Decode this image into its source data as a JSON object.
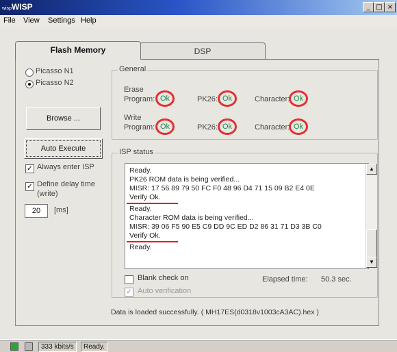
{
  "window": {
    "title_prefix": "wisp",
    "title": "WISP",
    "controls": [
      "_",
      "□",
      "×"
    ]
  },
  "menu": [
    "File",
    "View",
    "Settings",
    "Help"
  ],
  "tabs": [
    "Flash Memory",
    "DSP"
  ],
  "radios": [
    {
      "label": "Picasso N1",
      "selected": false
    },
    {
      "label": "Picasso N2",
      "selected": true
    }
  ],
  "buttons": {
    "browse": "Browse ...",
    "auto_execute": "Auto Execute"
  },
  "options": {
    "always_enter_isp": {
      "label": "Always enter ISP",
      "checked": true
    },
    "define_delay": {
      "label_1": "Define delay time",
      "label_2": "(write)",
      "checked": true
    }
  },
  "delay": {
    "value": "20",
    "unit": "[ms]"
  },
  "general": {
    "title": "General",
    "erase_label": "Erase",
    "write_label": "Write",
    "program_label": "Program:",
    "pk26_label": "PK26:",
    "character_label": "Character:",
    "ok": "Ok"
  },
  "isp": {
    "title": "ISP status",
    "log": [
      "Ready.",
      "PK26 ROM data is being verified...",
      "MISR: 17 56 89 79 50 FC F0 48 96 D4 71 15 09 B2 E4 0E",
      "Verify Ok.",
      "Ready.",
      "Character ROM data is being verified...",
      "MISR: 39 06 F5 90 E5 C9 DD 9C ED D2 86 31 71 D3 3B C0",
      "Verify Ok.",
      "Ready."
    ],
    "blank_check": {
      "label": "Blank check on",
      "checked": false
    },
    "auto_verification": {
      "label": "Auto verification",
      "checked": true
    },
    "elapsed_label": "Elapsed time:",
    "elapsed_value": "50.3 sec."
  },
  "message": "Data is loaded successfully. ( MH17ES(d0318v1003cA3AC).hex )",
  "status": {
    "speed": "333 kbits/s",
    "state": "Ready."
  },
  "colors": {
    "accent": "#2a55c8",
    "highlight": "#e02020",
    "ok": "#1a8a4a"
  }
}
